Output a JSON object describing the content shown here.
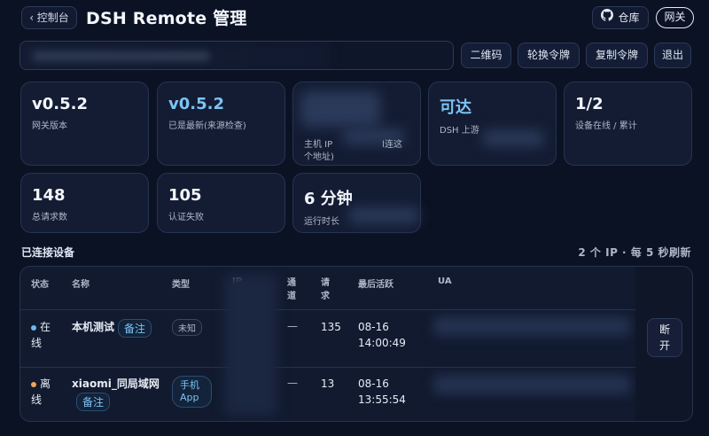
{
  "header": {
    "back_label": "‹ 控制台",
    "title": "DSH Remote 管理",
    "repo_label": "仓库",
    "gateway_badge": "网关"
  },
  "toolbar": {
    "qr_label": "二维码",
    "rotate_label": "轮换令牌",
    "copy_label": "复制令牌",
    "logout_label": "退出"
  },
  "stats": [
    {
      "value": "v0.5.2",
      "label": "网关版本"
    },
    {
      "value": "v0.5.2",
      "label": "已是最新(来源检查)"
    },
    {
      "value": "",
      "label_a": "主机 IP",
      "label_b": "l连这",
      "label_c": "个地址)"
    },
    {
      "value": "可达",
      "label": "DSH 上游"
    },
    {
      "value": "1/2",
      "label": "设备在线 / 累计"
    },
    {
      "value": "148",
      "label": "总请求数"
    },
    {
      "value": "105",
      "label": "认证失败"
    },
    {
      "value": "6 分钟",
      "label": "运行时长"
    }
  ],
  "devices": {
    "title": "已连接设备",
    "meta": "2 个 IP · 每 5 秒刷新",
    "columns": {
      "status": "状态",
      "name": "名称",
      "type": "类型",
      "ip": "IP",
      "channel_a": "通",
      "channel_b": "道",
      "requests_a": "请",
      "requests_b": "求",
      "last_active": "最后活跃",
      "ua": "UA"
    },
    "rows": [
      {
        "status_a": "在",
        "status_b": "线",
        "name": "本机测试",
        "note": "备注",
        "type": "未知",
        "channel": "—",
        "requests": "135",
        "last_date": "08-16",
        "last_time": "14:00:49",
        "disconnect_a": "断",
        "disconnect_b": "开"
      },
      {
        "status_a": "离",
        "status_b": "线",
        "name": "xiaomi_同局域网",
        "note": "备注",
        "type_a": "手机",
        "type_b": "App",
        "channel": "—",
        "requests": "13",
        "last_date": "08-16",
        "last_time": "13:55:54"
      }
    ]
  },
  "colors": {
    "background": "#0b1224",
    "accent_blue": "#7cc3f2",
    "online_dot": "#6fb8f0",
    "offline_dot": "#f0a35e"
  }
}
